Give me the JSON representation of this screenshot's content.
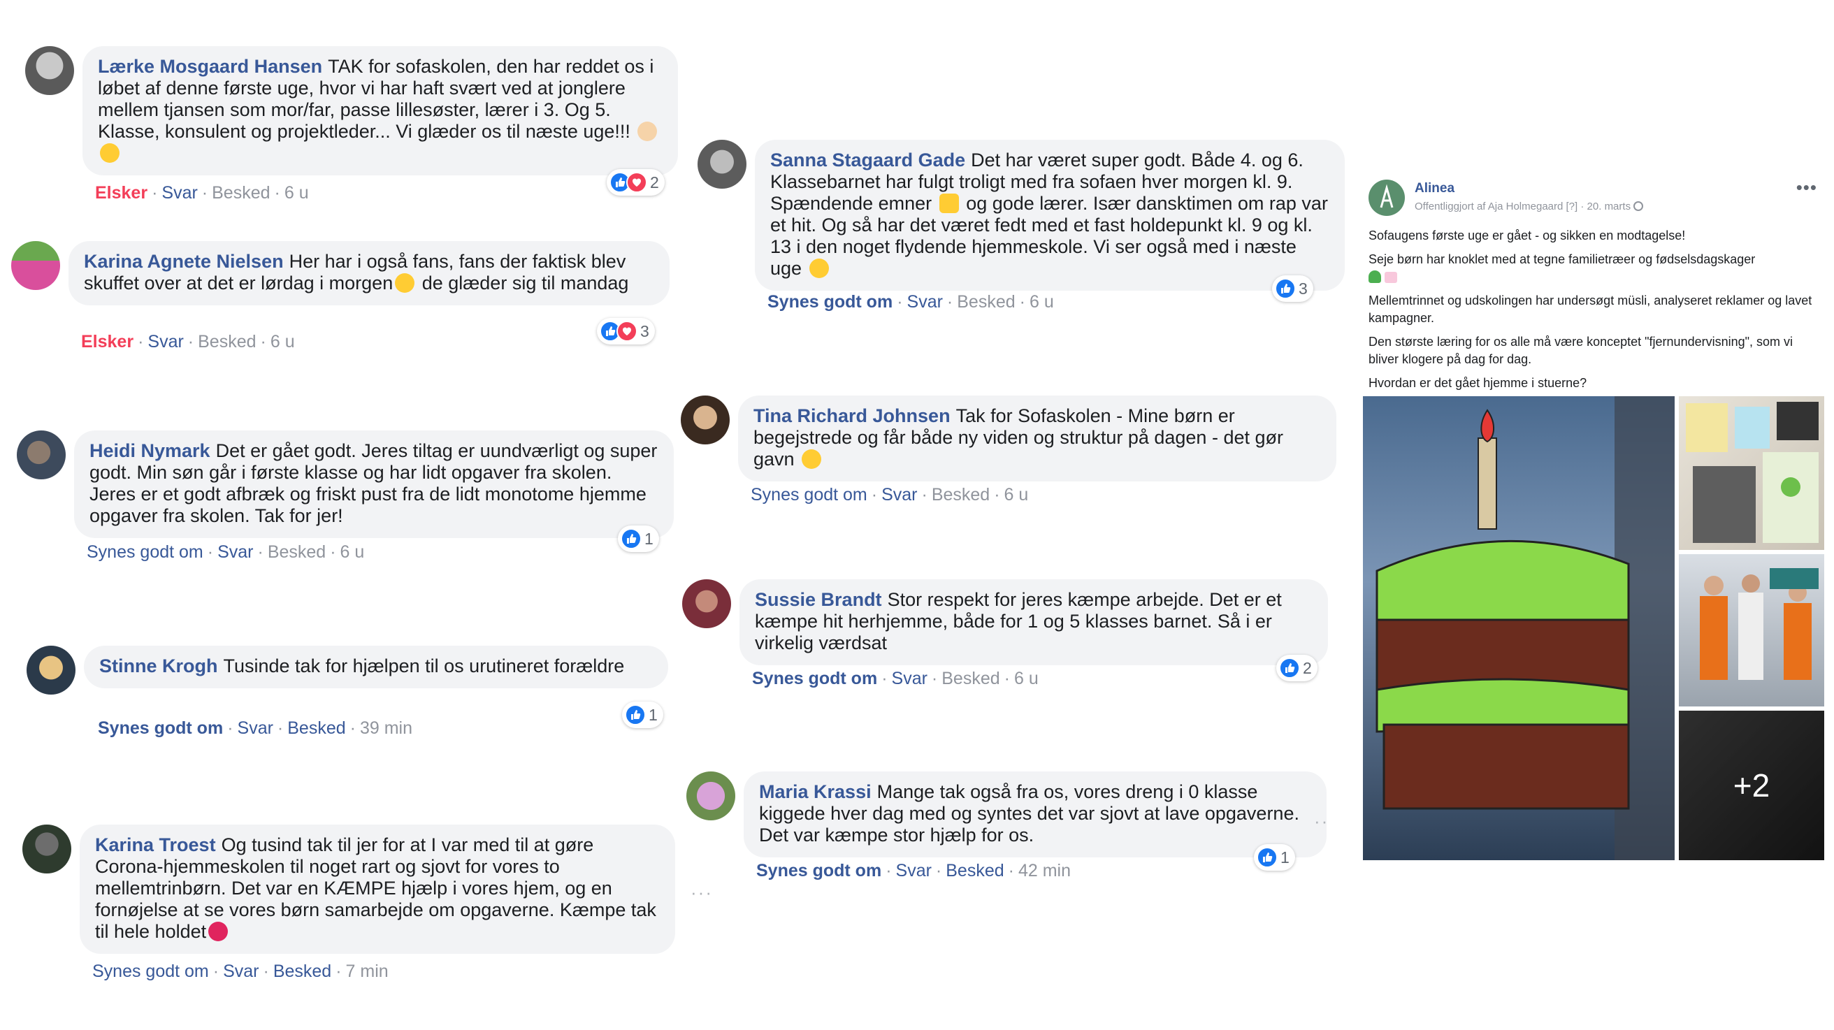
{
  "comments": [
    {
      "author": "Lærke Mosgaard Hansen",
      "text_parts": [
        "TAK for sofaskolen, den har reddet os i løbet af denne første uge, hvor vi har haft svært ved at jonglere mellem tjansen som mor/far, passe lillesøster, lærer i 3. Og 5. Klasse, konsulent og projektleder... Vi glæder os til næste uge!!!"
      ],
      "emojis": [
        "clapping-hands",
        "star-struck"
      ],
      "reaction_label": "Elsker",
      "reply_label": "Svar",
      "message_label": "Besked",
      "time": "6 u",
      "reaction_count": "2"
    },
    {
      "author": "Karina Agnete Nielsen",
      "text_parts": [
        "Her har i også fans, fans der faktisk blev skuffet over at det er lørdag i morgen",
        "de glæder sig til mandag"
      ],
      "emojis": [
        "crying-laughing"
      ],
      "reaction_label": "Elsker",
      "reply_label": "Svar",
      "message_label": "Besked",
      "time": "6 u",
      "reaction_count": "3"
    },
    {
      "author": "Heidi Nymark",
      "text_parts": [
        "Det er gået godt. Jeres tiltag er uundværligt og super godt. Min søn går i første klasse og har lidt opgaver fra skolen. Jeres er et godt afbræk og friskt pust fra de lidt monotome hjemme opgaver fra skolen. Tak for jer!"
      ],
      "reaction_label": "Synes godt om",
      "reply_label": "Svar",
      "message_label": "Besked",
      "time": "6 u",
      "reaction_count": "1"
    },
    {
      "author": "Stinne Krogh",
      "text_parts": [
        "Tusinde tak for hjælpen til os urutineret forældre"
      ],
      "reaction_label": "Synes godt om",
      "reply_label": "Svar",
      "message_label": "Besked",
      "time": "39 min",
      "reaction_count": "1"
    },
    {
      "author": "Karina Troest",
      "text_parts": [
        "Og tusind tak til jer for at I var med til at gøre Corona-hjemmeskolen til noget rart og sjovt for vores to mellemtrinbørn. Det var en KÆMPE hjælp i vores hjem, og en fornøjelse at se vores børn samarbejde om opgaverne. Kæmpe tak til hele holdet"
      ],
      "emojis": [
        "red-heart"
      ],
      "reaction_label": "Synes godt om",
      "reply_label": "Svar",
      "message_label": "Besked",
      "time": "7 min"
    },
    {
      "author": "Sanna Stagaard Gade",
      "text_parts": [
        "Det har været super godt. Både 4. og 6. Klassebarnet har fulgt troligt med fra sofaen hver morgen kl. 9. Spændende emner",
        "og gode lærer. Især dansktimen om rap var et hit. Og så har det været fedt med et fast holdepunkt kl. 9 og kl. 13 i den noget flydende hjemmeskole. Vi ser også med i næste uge"
      ],
      "emojis": [
        "thumbs-up",
        "smiling-face"
      ],
      "reaction_label": "Synes godt om",
      "reply_label": "Svar",
      "message_label": "Besked",
      "time": "6 u",
      "reaction_count": "3"
    },
    {
      "author": "Tina Richard Johnsen",
      "text_parts": [
        "Tak for Sofaskolen - Mine børn er begejstrede og får både ny viden og struktur på dagen - det gør gavn"
      ],
      "emojis": [
        "grinning-face"
      ],
      "reaction_label": "Synes godt om",
      "reply_label": "Svar",
      "message_label": "Besked",
      "time": "6 u"
    },
    {
      "author": "Sussie Brandt",
      "text_parts": [
        "Stor respekt for jeres kæmpe arbejde. Det er et kæmpe hit herhjemme, både for 1 og 5 klasses barnet. Så i er virkelig værdsat"
      ],
      "reaction_label": "Synes godt om",
      "reply_label": "Svar",
      "message_label": "Besked",
      "time": "6 u",
      "reaction_count": "2"
    },
    {
      "author": "Maria Krassi",
      "text_parts": [
        "Mange tak også fra os, vores dreng i 0 klasse kiggede hver dag med og syntes det var sjovt at lave opgaverne. Det var kæmpe stor hjælp for os."
      ],
      "reaction_label": "Synes godt om",
      "reply_label": "Svar",
      "message_label": "Besked",
      "time": "42 min",
      "reaction_count": "1"
    }
  ],
  "post": {
    "page_name": "Alinea",
    "meta_prefix": "Offentliggjort af Aja Holmegaard",
    "meta_q": "[?]",
    "meta_sep": "·",
    "meta_date": "20. marts",
    "more_label": "•••",
    "paragraphs": [
      "Sofaugens første uge er gået - og sikken en modtagelse!",
      "Seje børn har knoklet med at tegne familietræer og fødselsdagskager",
      "Mellemtrinnet og udskolingen har undersøgt müsli, analyseret reklamer og lavet kampagner.",
      "Den største læring for os alle må være konceptet \"fjernundervisning\", som vi bliver klogere på dag for dag.",
      "Hvordan er det gået hjemme i stuerne?"
    ],
    "extra_photos_label": "+2"
  },
  "colors": {
    "link": "#385898",
    "love": "#f33e58",
    "like": "#1877f2",
    "bubble": "#f2f3f5",
    "meta": "#90949c"
  }
}
